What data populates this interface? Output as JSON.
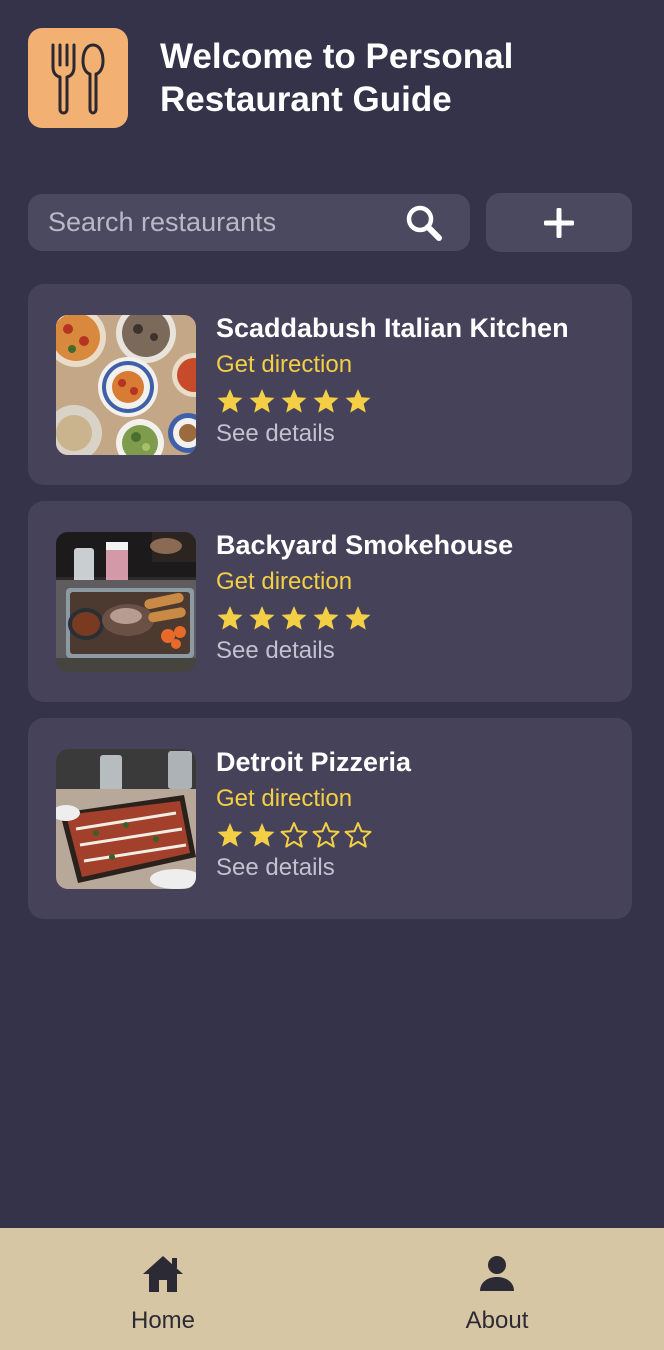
{
  "app": {
    "title": "Welcome to Personal Restaurant Guide",
    "logo_icon": "fork-spoon-icon",
    "accent_color": "#f2b173"
  },
  "search": {
    "placeholder": "Search restaurants",
    "value": "",
    "icon": "search-icon"
  },
  "toolbar": {
    "add_icon": "plus-icon"
  },
  "restaurants": [
    {
      "name": "Scaddabush Italian Kitchen",
      "direction_label": "Get direction",
      "rating": 5,
      "rating_max": 5,
      "details_label": "See details",
      "thumb": "pasta-pizza-photo"
    },
    {
      "name": "Backyard Smokehouse",
      "direction_label": "Get direction",
      "rating": 5,
      "rating_max": 5,
      "details_label": "See details",
      "thumb": "bbq-platter-photo"
    },
    {
      "name": "Detroit Pizzeria",
      "direction_label": "Get direction",
      "rating": 2,
      "rating_max": 5,
      "details_label": "See details",
      "thumb": "square-pizza-photo"
    }
  ],
  "nav": {
    "home_label": "Home",
    "home_icon": "home-icon",
    "about_label": "About",
    "about_icon": "person-icon"
  },
  "colors": {
    "background": "#35334a",
    "card": "#454259",
    "star": "#f3cf45",
    "link": "#f3cf45",
    "nav_bar": "#d6c6a3"
  }
}
